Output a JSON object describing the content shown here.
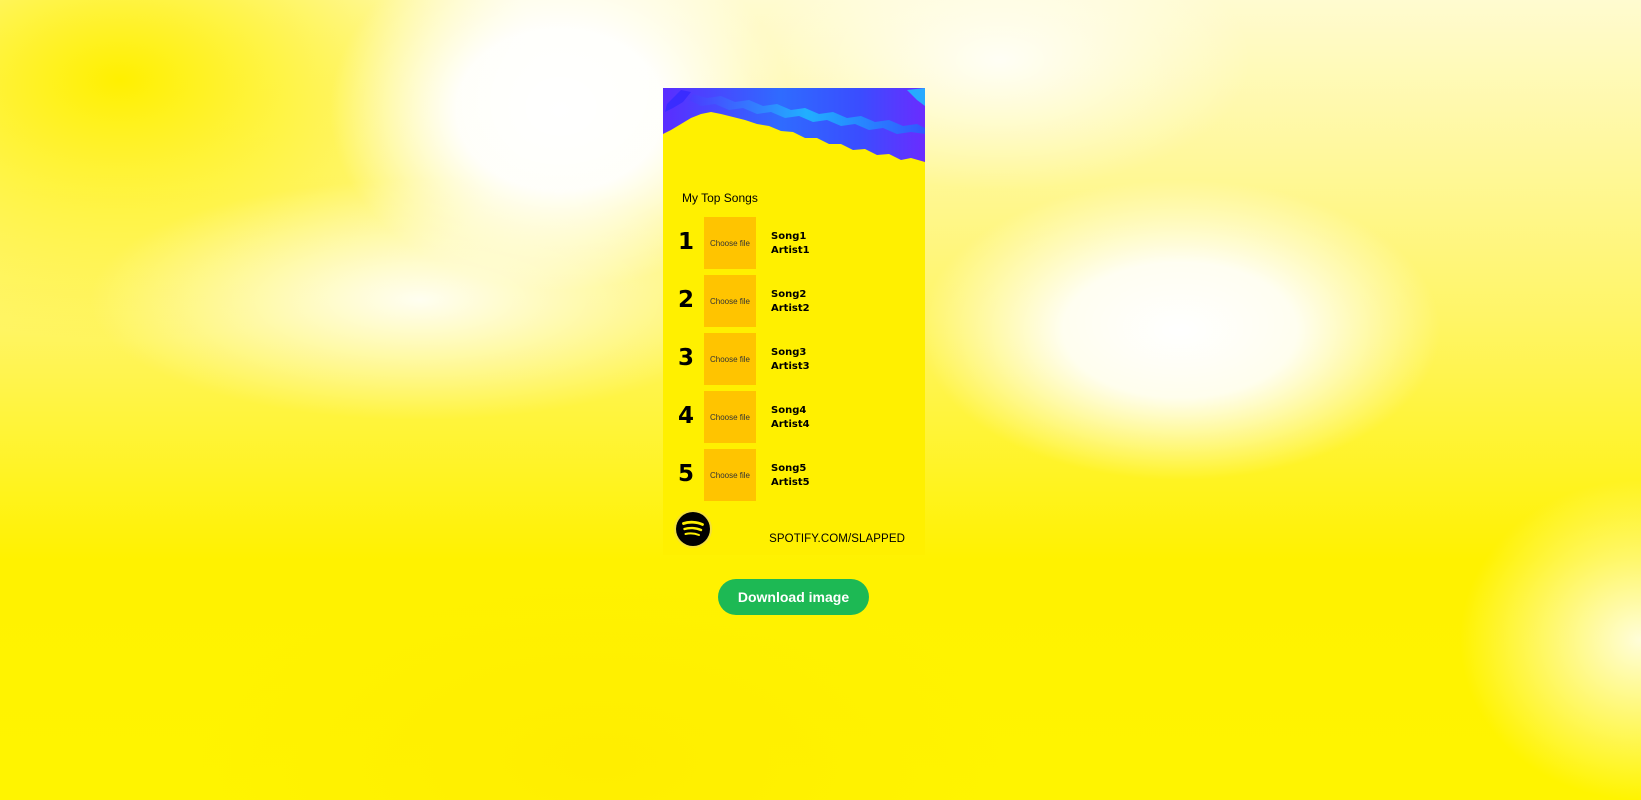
{
  "card": {
    "title": "My Top Songs",
    "file_button_label": "Choose file",
    "footer_url": "SPOTIFY.COM/SLAPPED",
    "logo_icon": "spotify-icon",
    "colors": {
      "card_background": "#fff000",
      "cover_placeholder": "#ffc400",
      "art_blue": "#2f5fff",
      "art_purple": "#6a2cff",
      "art_cyan": "#18c8ff"
    }
  },
  "tracks": [
    {
      "rank": "1",
      "song": "Song1",
      "artist": "Artist1"
    },
    {
      "rank": "2",
      "song": "Song2",
      "artist": "Artist2"
    },
    {
      "rank": "3",
      "song": "Song3",
      "artist": "Artist3"
    },
    {
      "rank": "4",
      "song": "Song4",
      "artist": "Artist4"
    },
    {
      "rank": "5",
      "song": "Song5",
      "artist": "Artist5"
    }
  ],
  "actions": {
    "download_label": "Download image",
    "download_color": "#1db954"
  }
}
